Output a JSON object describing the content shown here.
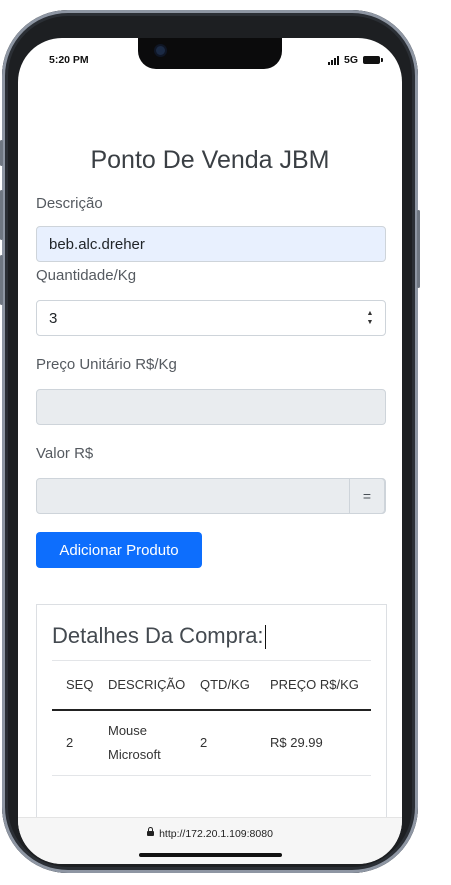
{
  "status_bar": {
    "time": "5:20 PM",
    "network": "5G"
  },
  "page": {
    "title": "Ponto De Venda JBM",
    "descricao_label": "Descrição",
    "descricao_value": "beb.alc.dreher",
    "quantidade_label": "Quantidade/Kg",
    "quantidade_value": "3",
    "preco_label": "Preço Unitário R$/Kg",
    "preco_value": "",
    "valor_label": "Valor R$",
    "valor_value": "",
    "valor_addon": "=",
    "add_button": "Adicionar Produto"
  },
  "purchase": {
    "title": "Detalhes Da Compra:",
    "columns": [
      "SEQ",
      "DESCRIÇÃO",
      "QTD/KG",
      "PREÇO R$/KG"
    ],
    "rows": [
      {
        "seq": "2",
        "descricao": "Mouse Microsoft",
        "qtd": "2",
        "preco": "R$ 29.99"
      }
    ]
  },
  "browser": {
    "url": "http://172.20.1.109:8080"
  },
  "colors": {
    "primary": "#0d6efd",
    "autofill": "#e8f0fe",
    "disabled": "#e9ecef"
  }
}
